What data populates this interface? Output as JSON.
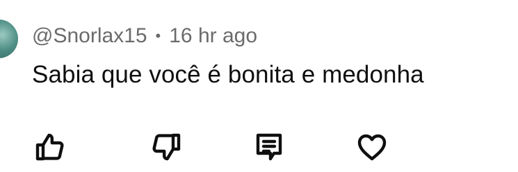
{
  "comment": {
    "author": "@Snorlax15",
    "separator": "•",
    "time": "16 hr ago",
    "text": "Sabia que você é bonita e medonha"
  },
  "actions": {
    "like_icon": "thumbs-up-icon",
    "dislike_icon": "thumbs-down-icon",
    "reply_icon": "comment-reply-icon",
    "heart_icon": "heart-icon"
  },
  "colors": {
    "text": "#0f0f0f",
    "meta": "#6b6b6b",
    "background": "#ffffff"
  }
}
